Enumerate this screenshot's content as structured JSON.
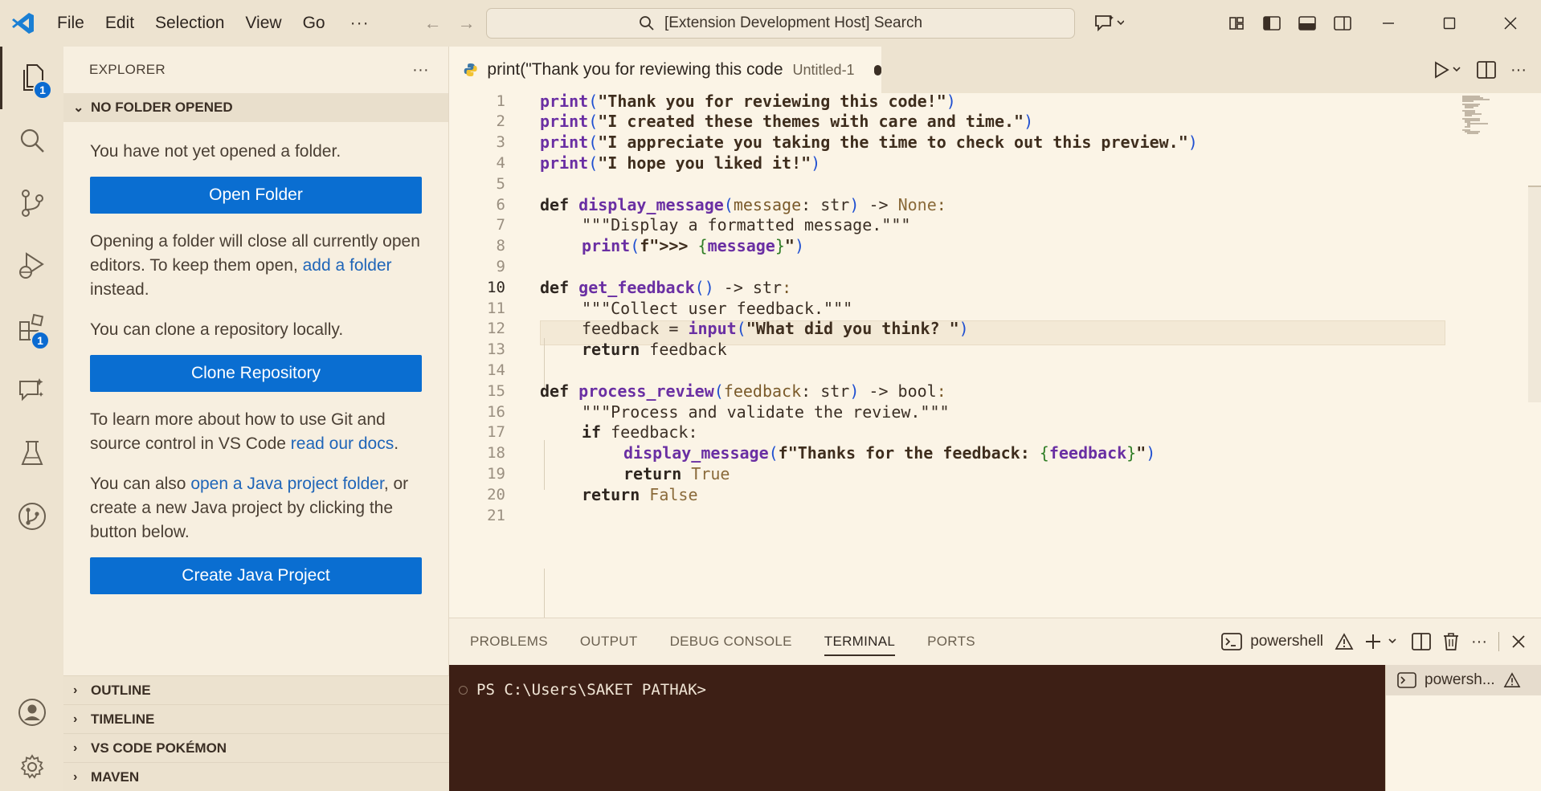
{
  "titlebar": {
    "menu": [
      "File",
      "Edit",
      "Selection",
      "View",
      "Go"
    ],
    "more": "···",
    "search": "[Extension Development Host] Search"
  },
  "activity": {
    "explorer_badge": "1",
    "extensions_badge": "1"
  },
  "sidebar": {
    "title": "EXPLORER",
    "more": "···",
    "section": "NO FOLDER OPENED",
    "p1": "You have not yet opened a folder.",
    "open_folder": "Open Folder",
    "p2a": "Opening a folder will close all currently open editors. To keep them open, ",
    "p2link": "add a folder",
    "p2b": " instead.",
    "p3": "You can clone a repository locally.",
    "clone": "Clone Repository",
    "p4a": "To learn more about how to use Git and source control in VS Code ",
    "p4link": "read our docs",
    "p4b": ".",
    "p5a": "You can also ",
    "p5link": "open a Java project folder",
    "p5b": ", or create a new Java project by clicking the button below.",
    "create_java": "Create Java Project",
    "footer": [
      "OUTLINE",
      "TIMELINE",
      "VS CODE POKÉMON",
      "MAVEN"
    ]
  },
  "tab": {
    "name": "print(\"Thank you for reviewing this code",
    "sub": "Untitled-1"
  },
  "editor": {
    "current_line": 10,
    "line_numbers": [
      "1",
      "2",
      "3",
      "4",
      "5",
      "6",
      "7",
      "8",
      "9",
      "10",
      "11",
      "12",
      "13",
      "14",
      "15",
      "16",
      "17",
      "18",
      "19",
      "20",
      "21"
    ],
    "l1": [
      "print",
      "(",
      "\"Thank you for reviewing this code!\"",
      ")"
    ],
    "l2": [
      "print",
      "(",
      "\"I created these themes with care and time.\"",
      ")"
    ],
    "l3": [
      "print",
      "(",
      "\"I appreciate you taking the time to check out this preview.\"",
      ")"
    ],
    "l4": [
      "print",
      "(",
      "\"I hope you liked it!\"",
      ")"
    ],
    "l6": [
      "def ",
      "display_message",
      "(",
      "message",
      ": str",
      ")",
      " -> ",
      "None",
      ":"
    ],
    "l7": "\"\"\"Display a formatted message.\"\"\"",
    "l8": [
      "print",
      "(",
      "f\">>> ",
      "{",
      "message",
      "}",
      "\"",
      ")"
    ],
    "l10": [
      "def ",
      "get_feedback",
      "()",
      " -> str",
      ":"
    ],
    "l11": "\"\"\"Collect user feedback.\"\"\"",
    "l12": [
      "feedback = ",
      "input",
      "(",
      "\"What did you think? \"",
      ")"
    ],
    "l13": [
      "return ",
      "feedback"
    ],
    "l15": [
      "def ",
      "process_review",
      "(",
      "feedback",
      ": str",
      ")",
      " -> bool",
      ":"
    ],
    "l16": "\"\"\"Process and validate the review.\"\"\"",
    "l17": [
      "if ",
      "feedback:"
    ],
    "l18": [
      "display_message",
      "(",
      "f\"Thanks for the feedback: ",
      "{",
      "feedback",
      "}",
      "\"",
      ")"
    ],
    "l19": [
      "return ",
      "True"
    ],
    "l20": [
      "return ",
      "False"
    ]
  },
  "panel": {
    "tabs": [
      "PROBLEMS",
      "OUTPUT",
      "DEBUG CONSOLE",
      "TERMINAL",
      "PORTS"
    ],
    "shell": "powershell",
    "prompt": "PS C:\\Users\\SAKET PATHAK>",
    "term_item": "powersh..."
  }
}
